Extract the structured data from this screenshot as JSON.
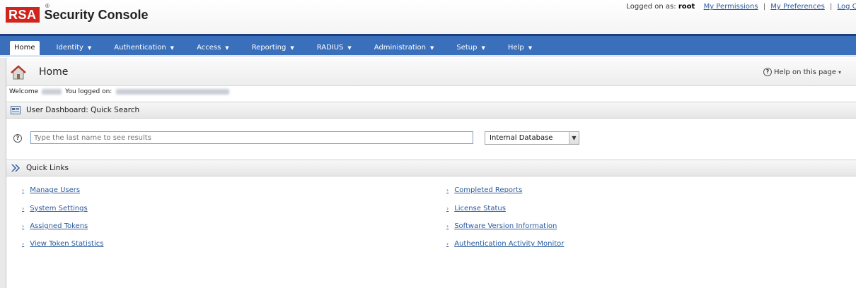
{
  "header": {
    "brand": "RSA",
    "app_title": "Security Console",
    "logged_on_label": "Logged on as:",
    "user": "root",
    "links": [
      "My Permissions",
      "My Preferences",
      "Log Of"
    ]
  },
  "nav": {
    "items": [
      {
        "label": "Home",
        "dropdown": false,
        "active": true
      },
      {
        "label": "Identity",
        "dropdown": true
      },
      {
        "label": "Authentication",
        "dropdown": true
      },
      {
        "label": "Access",
        "dropdown": true
      },
      {
        "label": "Reporting",
        "dropdown": true
      },
      {
        "label": "RADIUS",
        "dropdown": true
      },
      {
        "label": "Administration",
        "dropdown": true
      },
      {
        "label": "Setup",
        "dropdown": true
      },
      {
        "label": "Help",
        "dropdown": true
      }
    ],
    "color": "#3a6fbc"
  },
  "page": {
    "title": "Home",
    "help_label": "Help on this page",
    "welcome_label": "Welcome",
    "logged_on_text": "You logged on:"
  },
  "dashboard": {
    "title": "User Dashboard: Quick Search",
    "search_placeholder": "Type the last name to see results",
    "identity_source": "Internal Database"
  },
  "quick_links": {
    "title": "Quick Links",
    "left": [
      "Manage Users",
      "System Settings",
      "Assigned Tokens",
      "View Token Statistics"
    ],
    "right": [
      "Completed Reports",
      "License Status",
      "Software Version Information",
      "Authentication Activity Monitor"
    ]
  },
  "colors": {
    "brand_red": "#d1241c",
    "link_blue": "#2a5b9e"
  }
}
